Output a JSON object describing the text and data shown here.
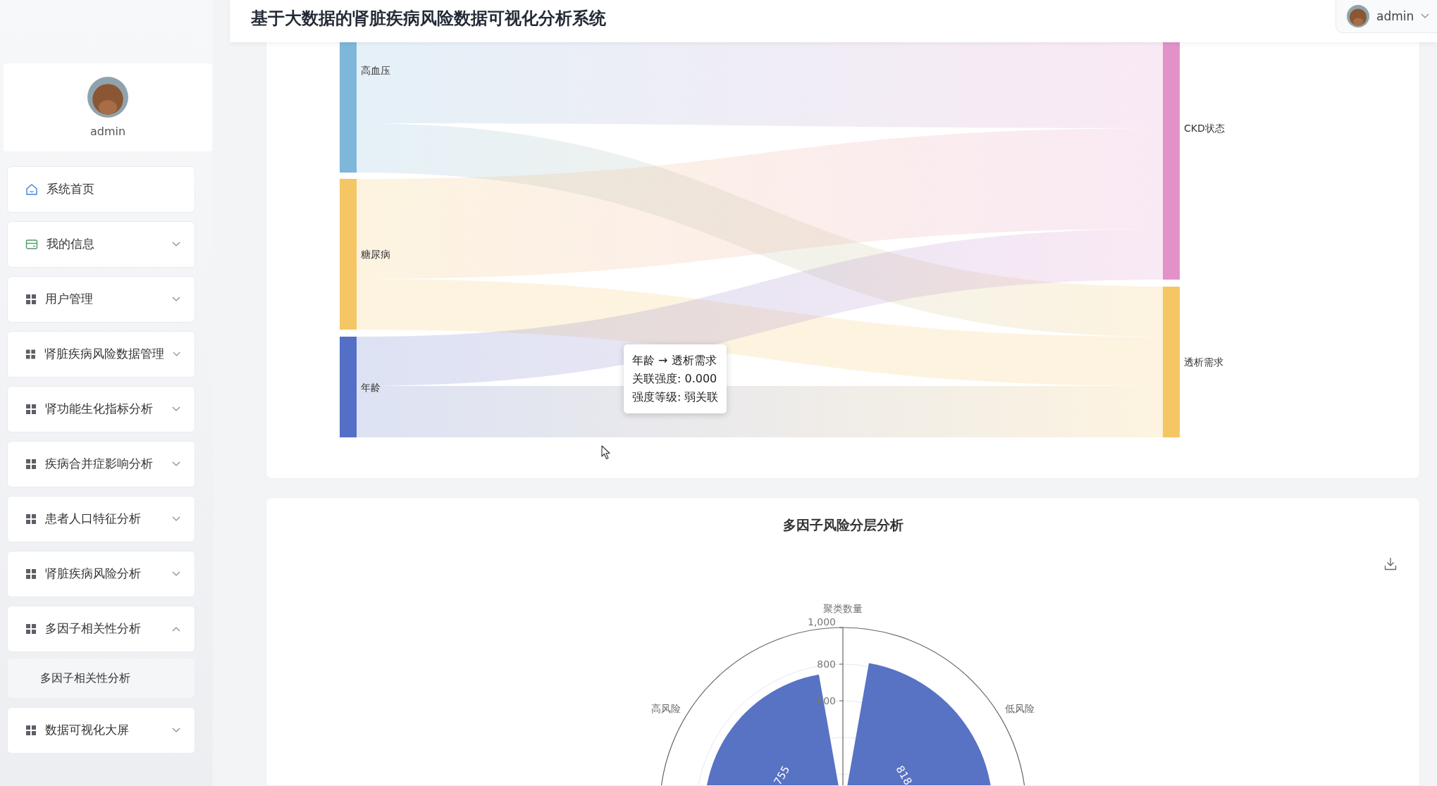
{
  "header": {
    "title": "基于大数据的肾脏疾病风险数据可视化分析系统",
    "user_menu": {
      "name": "admin"
    }
  },
  "sidebar": {
    "profile": {
      "name": "admin"
    },
    "menu": [
      {
        "label": "系统首页",
        "kind": "home"
      },
      {
        "label": "我的信息",
        "kind": "card",
        "expanded": false
      },
      {
        "label": "用户管理",
        "kind": "grid",
        "expanded": false
      },
      {
        "label": "肾脏疾病风险数据管理",
        "kind": "grid",
        "expanded": false
      },
      {
        "label": "肾功能生化指标分析",
        "kind": "grid",
        "expanded": false
      },
      {
        "label": "疾病合并症影响分析",
        "kind": "grid",
        "expanded": false
      },
      {
        "label": "患者人口特征分析",
        "kind": "grid",
        "expanded": false
      },
      {
        "label": "肾脏疾病风险分析",
        "kind": "grid",
        "expanded": false
      },
      {
        "label": "多因子相关性分析",
        "kind": "grid",
        "expanded": true,
        "children": [
          {
            "label": "多因子相关性分析"
          }
        ]
      },
      {
        "label": "数据可视化大屏",
        "kind": "grid",
        "expanded": false
      }
    ]
  },
  "sankey": {
    "source_nodes": [
      {
        "label": "高血压",
        "color": "#7eb7da"
      },
      {
        "label": "糖尿病",
        "color": "#f5c664"
      },
      {
        "label": "年龄",
        "color": "#5470c6"
      }
    ],
    "target_nodes": [
      {
        "label": "CKD状态",
        "color": "#e392c9"
      },
      {
        "label": "透析需求",
        "color": "#f5c664"
      }
    ],
    "tooltip": {
      "lines": [
        "年龄 → 透析需求",
        "关联强度: 0.000",
        "强度等级: 弱关联"
      ]
    }
  },
  "risk_panel": {
    "title": "多因子风险分层分析",
    "polar_chart": {
      "axis_title": "聚类数量",
      "ticks": [
        "1,000",
        "800",
        "600"
      ],
      "bars": [
        {
          "label": "高风险",
          "value": "755"
        },
        {
          "label": "低风险",
          "value": "818"
        }
      ]
    }
  }
}
